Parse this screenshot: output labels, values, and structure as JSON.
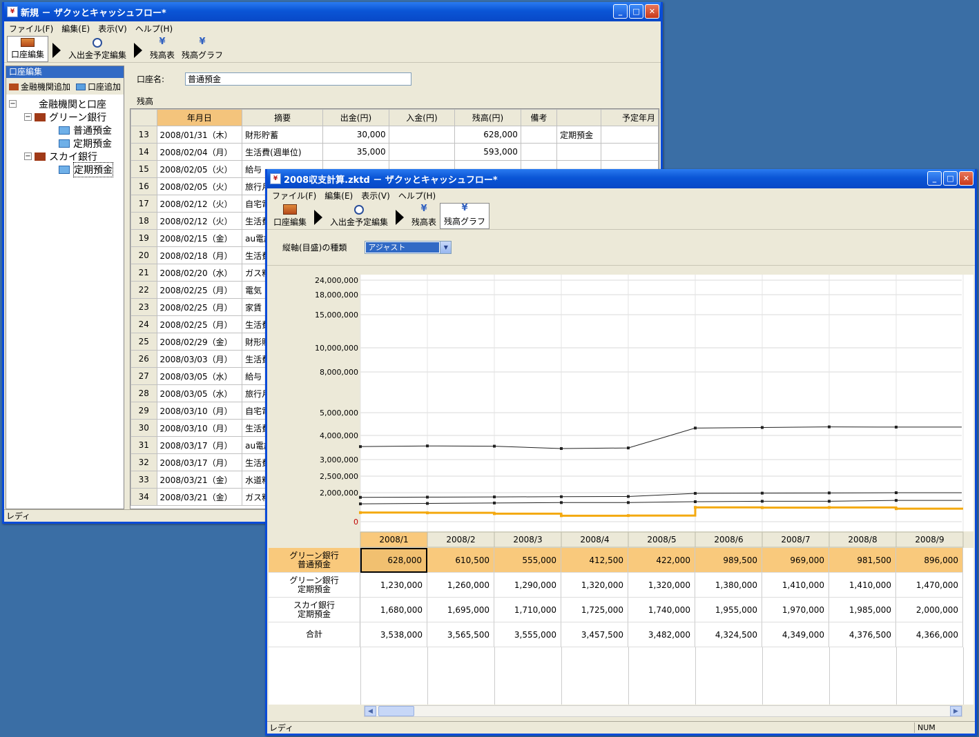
{
  "win1": {
    "title": "新規 － ザクッとキャッシュフロー*",
    "menu": [
      "ファイル(F)",
      "編集(E)",
      "表示(V)",
      "ヘルプ(H)"
    ],
    "toolbar": [
      "口座編集",
      "入出金予定編集",
      "残高表",
      "残高グラフ"
    ],
    "left_header": "口座編集",
    "left_tools": [
      "金融機関追加",
      "口座追加"
    ],
    "tree": {
      "root": "金融機関と口座",
      "bank1": "グリーン銀行",
      "bank1_acct1": "普通預金",
      "bank1_acct2": "定期預金",
      "bank2": "スカイ銀行",
      "bank2_acct1": "定期預金"
    },
    "acct_label": "口座名:",
    "acct_value": "普通預金",
    "balance_label": "残高",
    "columns": [
      "年月日",
      "摘要",
      "出金(円)",
      "入金(円)",
      "残高(円)",
      "備考",
      "",
      "予定年月"
    ],
    "rows": [
      [
        "13",
        "2008/01/31（木）",
        "財形貯蓄",
        "30,000",
        "",
        "628,000",
        "",
        "定期預金",
        ""
      ],
      [
        "14",
        "2008/02/04（月）",
        "生活費(週単位)",
        "35,000",
        "",
        "593,000",
        "",
        "",
        ""
      ],
      [
        "15",
        "2008/02/05（火）",
        "給与",
        "",
        "",
        "",
        "",
        "",
        ""
      ],
      [
        "16",
        "2008/02/05（火）",
        "旅行月",
        "",
        "",
        "",
        "",
        "",
        ""
      ],
      [
        "17",
        "2008/02/12（火）",
        "自宅電",
        "",
        "",
        "",
        "",
        "",
        ""
      ],
      [
        "18",
        "2008/02/12（火）",
        "生活費",
        "",
        "",
        "",
        "",
        "",
        ""
      ],
      [
        "19",
        "2008/02/15（金）",
        "au電話",
        "",
        "",
        "",
        "",
        "",
        ""
      ],
      [
        "20",
        "2008/02/18（月）",
        "生活費",
        "",
        "",
        "",
        "",
        "",
        ""
      ],
      [
        "21",
        "2008/02/20（水）",
        "ガス料",
        "",
        "",
        "",
        "",
        "",
        ""
      ],
      [
        "22",
        "2008/02/25（月）",
        "電気",
        "",
        "",
        "",
        "",
        "",
        ""
      ],
      [
        "23",
        "2008/02/25（月）",
        "家賃",
        "",
        "",
        "",
        "",
        "",
        ""
      ],
      [
        "24",
        "2008/02/25（月）",
        "生活費",
        "",
        "",
        "",
        "",
        "",
        ""
      ],
      [
        "25",
        "2008/02/29（金）",
        "財形貯",
        "",
        "",
        "",
        "",
        "",
        ""
      ],
      [
        "26",
        "2008/03/03（月）",
        "生活費",
        "",
        "",
        "",
        "",
        "",
        ""
      ],
      [
        "27",
        "2008/03/05（水）",
        "給与",
        "",
        "",
        "",
        "",
        "",
        ""
      ],
      [
        "28",
        "2008/03/05（水）",
        "旅行月",
        "",
        "",
        "",
        "",
        "",
        ""
      ],
      [
        "29",
        "2008/03/10（月）",
        "自宅電",
        "",
        "",
        "",
        "",
        "",
        ""
      ],
      [
        "30",
        "2008/03/10（月）",
        "生活費",
        "",
        "",
        "",
        "",
        "",
        ""
      ],
      [
        "31",
        "2008/03/17（月）",
        "au電話",
        "",
        "",
        "",
        "",
        "",
        ""
      ],
      [
        "32",
        "2008/03/17（月）",
        "生活費",
        "",
        "",
        "",
        "",
        "",
        ""
      ],
      [
        "33",
        "2008/03/21（金）",
        "水道料",
        "",
        "",
        "",
        "",
        "",
        ""
      ],
      [
        "34",
        "2008/03/21（金）",
        "ガス料",
        "",
        "",
        "",
        "",
        "",
        ""
      ]
    ],
    "status": "レディ"
  },
  "win2": {
    "title": "2008収支計算.zktd － ザクッとキャッシュフロー*",
    "menu": [
      "ファイル(F)",
      "編集(E)",
      "表示(V)",
      "ヘルプ(H)"
    ],
    "toolbar": [
      "口座編集",
      "入出金予定編集",
      "残高表",
      "残高グラフ"
    ],
    "axis_label": "縦軸(目盛)の種類",
    "axis_value": "アジャスト",
    "status": "レディ",
    "num_indicator": "NUM"
  },
  "colors": {
    "orange_series": "#f4a90f",
    "dark_series": "#222222",
    "highlight": "#f9c97c"
  },
  "chart_data": {
    "type": "line",
    "y_scale": "adjusted",
    "y_ticks": [
      "24,000,000",
      "18,000,000",
      "15,000,000",
      "10,000,000",
      "8,000,000",
      "5,000,000",
      "4,000,000",
      "3,000,000",
      "2,500,000",
      "2,000,000",
      "0"
    ],
    "x": [
      "2008/1",
      "2008/2",
      "2008/3",
      "2008/4",
      "2008/5",
      "2008/6",
      "2008/7",
      "2008/8",
      "2008/9"
    ],
    "series": [
      {
        "name": "グリーン銀行 普通預金",
        "values": [
          628000,
          610500,
          555000,
          412500,
          422000,
          989500,
          969000,
          981500,
          896000
        ]
      },
      {
        "name": "グリーン銀行 定期預金",
        "values": [
          1230000,
          1260000,
          1290000,
          1320000,
          1320000,
          1380000,
          1410000,
          1410000,
          1470000
        ]
      },
      {
        "name": "スカイ銀行 定期預金",
        "values": [
          1680000,
          1695000,
          1710000,
          1725000,
          1740000,
          1955000,
          1970000,
          1985000,
          2000000
        ]
      },
      {
        "name": "合計",
        "values": [
          3538000,
          3565500,
          3555000,
          3457500,
          3482000,
          4324500,
          4349000,
          4376500,
          4366000
        ]
      }
    ]
  },
  "table_rows": [
    {
      "label1": "グリーン銀行",
      "label2": "普通預金",
      "values": [
        "628,000",
        "610,500",
        "555,000",
        "412,500",
        "422,000",
        "989,500",
        "969,000",
        "981,500",
        "896,000"
      ]
    },
    {
      "label1": "グリーン銀行",
      "label2": "定期預金",
      "values": [
        "1,230,000",
        "1,260,000",
        "1,290,000",
        "1,320,000",
        "1,320,000",
        "1,380,000",
        "1,410,000",
        "1,410,000",
        "1,470,000"
      ]
    },
    {
      "label1": "スカイ銀行",
      "label2": "定期預金",
      "values": [
        "1,680,000",
        "1,695,000",
        "1,710,000",
        "1,725,000",
        "1,740,000",
        "1,955,000",
        "1,970,000",
        "1,985,000",
        "2,000,000"
      ]
    },
    {
      "label1": "合計",
      "label2": "",
      "values": [
        "3,538,000",
        "3,565,500",
        "3,555,000",
        "3,457,500",
        "3,482,000",
        "4,324,500",
        "4,349,000",
        "4,376,500",
        "4,366,000"
      ]
    }
  ]
}
